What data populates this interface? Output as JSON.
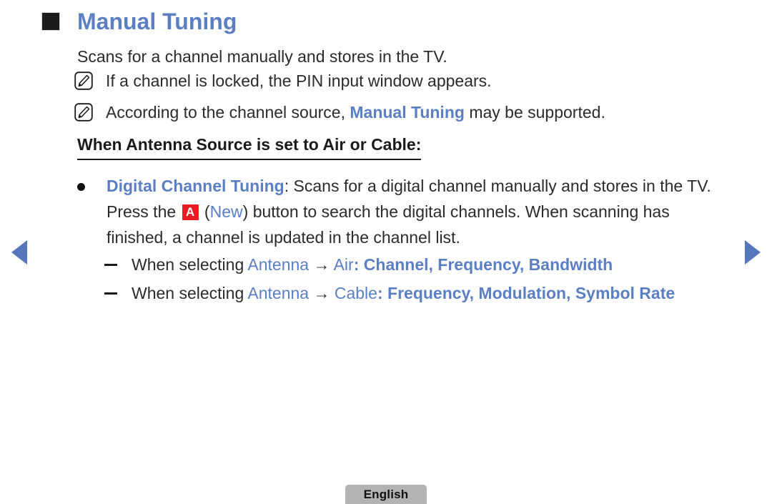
{
  "page": {
    "title": "Manual Tuning",
    "square_bullet_icon": "filled-square-icon",
    "intro": "Scans for a channel manually and stores in the TV.",
    "notes": [
      {
        "icon": "note-pencil-icon",
        "text": "If a channel is locked, the PIN input window appears."
      },
      {
        "icon": "note-pencil-icon",
        "prefix": "According to the channel source, ",
        "emphasis": "Manual Tuning",
        "suffix": " may be supported."
      }
    ],
    "subheading": "When Antenna Source is set to Air or Cable:",
    "bullet": {
      "marker_icon": "dot-bullet-icon",
      "term": "Digital Channel Tuning",
      "body_part_1": ": Scans for a digital channel manually and stores in the TV. Press the ",
      "key_label": "A",
      "paren_open": " (",
      "key_name": "New",
      "paren_close": ") ",
      "body_part_2": "button to search the digital channels. When scanning has finished, a channel is updated in the channel list."
    },
    "sub_items": [
      {
        "marker_icon": "dash-bullet-icon",
        "lead": "When selecting ",
        "source_label": "Antenna",
        "arrow": " → ",
        "mode_label": "Air",
        "colon": ": ",
        "fields": "Channel, Frequency, Bandwidth"
      },
      {
        "marker_icon": "dash-bullet-icon",
        "lead": "When selecting ",
        "source_label": "Antenna",
        "arrow": " → ",
        "mode_label": "Cable",
        "colon": ": ",
        "fields": "Frequency, Modulation, Symbol Rate"
      }
    ],
    "nav": {
      "prev_icon": "triangle-left-icon",
      "next_icon": "triangle-right-icon"
    },
    "footer": {
      "language": "English"
    },
    "colors": {
      "accent_blue": "#5b7fc2",
      "arrow_blue": "#5577bb",
      "key_red": "#ea1b25",
      "badge_gray": "#b3b3b3",
      "text_black": "#2b2b2b"
    }
  }
}
